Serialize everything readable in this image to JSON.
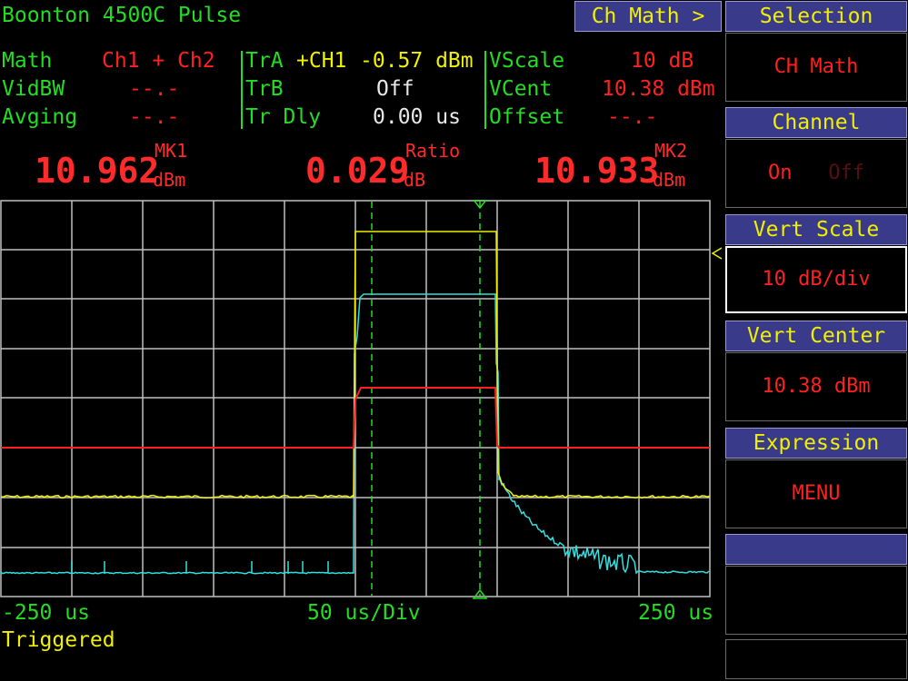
{
  "header": {
    "title": "Boonton 4500C Pulse",
    "ch_math_button": "Ch Math >"
  },
  "params": {
    "math_label": "Math",
    "math_value": "Ch1 + Ch2",
    "vidbw_label": "VidBW",
    "vidbw_value": "--.-",
    "avging_label": "Avging",
    "avging_value": "--.-",
    "tra_label": "TrA",
    "tra_channel": "+CH1",
    "tra_value": "-0.57 dBm",
    "trb_label": "TrB",
    "trb_value": "Off",
    "trdly_label": "Tr Dly",
    "trdly_value": "0.00 us",
    "vscale_label": "VScale",
    "vscale_value": "10 dB",
    "vcent_label": "VCent",
    "vcent_value": "10.38 dBm",
    "offset_label": "Offset",
    "offset_value": "--.-"
  },
  "markers": {
    "mk1_value": "10.962",
    "mk1_label": "MK1",
    "mk1_unit": "dBm",
    "ratio_value": "0.029",
    "ratio_label": "Ratio",
    "ratio_unit": "dB",
    "mk2_value": "10.933",
    "mk2_label": "MK2",
    "mk2_unit": "dBm"
  },
  "axis": {
    "left": "-250 us",
    "center": "50 us/Div",
    "right": "250 us"
  },
  "status": "Triggered",
  "softkeys": [
    {
      "header": "Selection",
      "value": "CH Math"
    },
    {
      "header": "Channel",
      "value_on": "On",
      "value_off": "Off"
    },
    {
      "header": "Vert Scale",
      "value": "10 dB/div"
    },
    {
      "header": "Vert Center",
      "value": "10.38 dBm"
    },
    {
      "header": "Expression",
      "value": "MENU"
    },
    {
      "header": "",
      "value": ""
    }
  ],
  "colors": {
    "ch1": "#f0f000",
    "ch2": "#30e0e0",
    "math": "#ff2020",
    "grid": "#bfbfbf",
    "marker": "#22dd22"
  }
}
